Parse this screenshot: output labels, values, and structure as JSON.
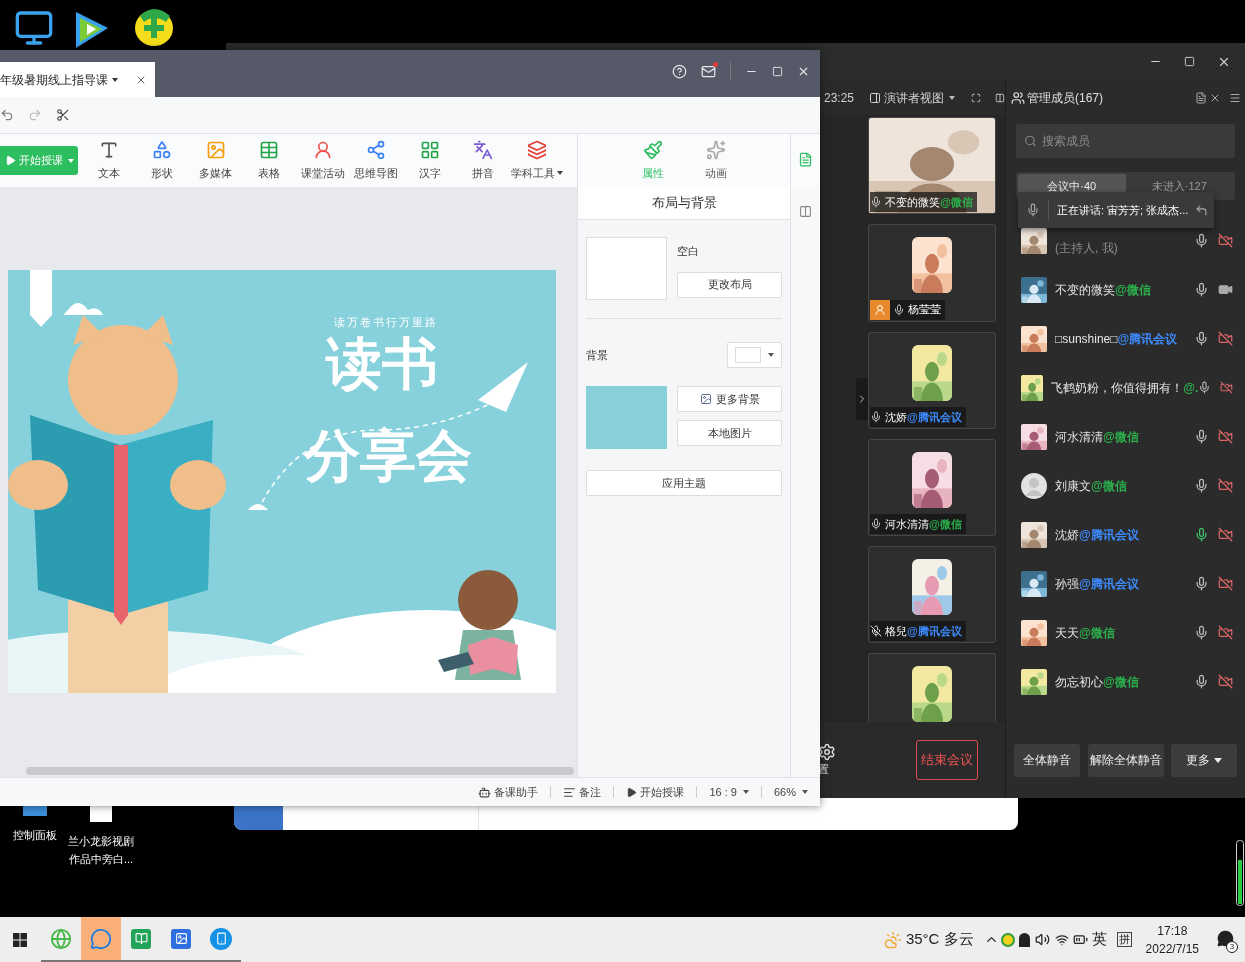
{
  "desktop": {
    "bottom_icons": [
      {
        "kind": "control",
        "lines": [
          "控制面板"
        ]
      },
      {
        "kind": "file",
        "lines": [
          "兰小龙影视剧",
          "作品中旁白..."
        ]
      }
    ]
  },
  "editor": {
    "tab_title": "年级暑期线上指导课",
    "start_button": "开始授课",
    "tools": [
      {
        "kind": "text",
        "label": "文本",
        "has_menu": false
      },
      {
        "kind": "shape",
        "label": "形状",
        "has_menu": false
      },
      {
        "kind": "media",
        "label": "多媒体",
        "has_menu": false
      },
      {
        "kind": "table",
        "label": "表格",
        "has_menu": false
      },
      {
        "kind": "activity",
        "label": "课堂活动",
        "has_menu": false
      },
      {
        "kind": "mindmap",
        "label": "思维导图",
        "has_menu": false
      },
      {
        "kind": "hanzi",
        "label": "汉字",
        "has_menu": false
      },
      {
        "kind": "pinyin",
        "label": "拼音",
        "has_menu": false
      },
      {
        "kind": "subject",
        "label": "学科工具",
        "has_menu": true
      }
    ],
    "side_tabs": [
      {
        "kind": "props",
        "label": "属性",
        "selected": true
      },
      {
        "kind": "anim",
        "label": "动画",
        "selected": false
      }
    ],
    "slide": {
      "subtitle": "读万卷书行万里路",
      "title_line1": "读书",
      "title_line2": "分享会"
    },
    "panel": {
      "title": "布局与背景",
      "layout_name": "空白",
      "change_layout": "更改布局",
      "background_label": "背景",
      "more_backgrounds": "更多背景",
      "local_image": "本地图片",
      "apply_theme": "应用主题"
    },
    "status_bar": [
      {
        "kind": "assistant",
        "label": "备课助手"
      },
      {
        "kind": "notes",
        "label": "备注"
      },
      {
        "kind": "play",
        "label": "开始授课"
      },
      {
        "kind": "menu",
        "label": "16 : 9"
      },
      {
        "kind": "menu",
        "label": "66%"
      }
    ]
  },
  "meeting": {
    "time": "23:25",
    "view_mode": "演讲者视图",
    "settings_label": "置",
    "end_button": "结束会议",
    "tiles": [
      {
        "kind": "video",
        "name": "不变的微笑",
        "source": "@微信",
        "color": "#2bb24c",
        "host": false,
        "mic_muted": false
      },
      {
        "kind": "avatar",
        "name": "杨莹莹",
        "host": true,
        "mic_muted": false
      },
      {
        "kind": "avatar",
        "name": "沈娇",
        "source": "@腾讯会议",
        "color": "#3d8bfd",
        "host": false,
        "mic_muted": false
      },
      {
        "kind": "avatar",
        "name": "河水清清",
        "source": "@微信",
        "color": "#2bb24c",
        "host": false,
        "mic_muted": false
      },
      {
        "kind": "avatar",
        "name": "格兒",
        "source": "@腾讯会议",
        "color": "#3d8bfd",
        "host": false,
        "mic_muted": true
      }
    ],
    "members": {
      "title": "管理成员(167)",
      "search_placeholder": "搜索成员",
      "tabs": [
        {
          "label": "会议中·40",
          "selected": true
        },
        {
          "label": "未进入·127",
          "selected": false
        }
      ],
      "speaking_banner": "正在讲话: 宙芳芳; 张成杰...",
      "rows": [
        {
          "kind": "host",
          "note": "(主持人, 我)",
          "camera_on": false,
          "speaking": false
        },
        {
          "kind": "member",
          "name": "不变的微笑",
          "source": "@微信",
          "color": "#2bb24c",
          "camera_on": true,
          "speaking": false
        },
        {
          "kind": "member",
          "name": "□sunshine□",
          "source": "@腾讯会议",
          "color": "#3d8bfd",
          "camera_on": false,
          "speaking": false
        },
        {
          "kind": "member",
          "name": "飞鹤奶粉，你值得拥有！",
          "source": "@.",
          "color": "#2bb24c",
          "camera_on": false,
          "speaking": false
        },
        {
          "kind": "member",
          "name": "河水清清",
          "source": "@微信",
          "color": "#2bb24c",
          "camera_on": false,
          "speaking": false
        },
        {
          "kind": "silhouette",
          "name": "刘康文",
          "source": "@微信",
          "color": "#2bb24c",
          "camera_on": false,
          "speaking": false
        },
        {
          "kind": "member",
          "name": "沈娇",
          "source": "@腾讯会议",
          "color": "#3d8bfd",
          "camera_on": false,
          "speaking": true
        },
        {
          "kind": "member",
          "name": "孙强",
          "source": "@腾讯会议",
          "color": "#3d8bfd",
          "camera_on": false,
          "speaking": false
        },
        {
          "kind": "member",
          "name": "天天",
          "source": "@微信",
          "color": "#2bb24c",
          "camera_on": false,
          "speaking": false
        },
        {
          "kind": "member",
          "name": "勿忘初心",
          "source": "@微信",
          "color": "#2bb24c",
          "camera_on": false,
          "speaking": false
        }
      ],
      "buttons": [
        {
          "kind": "plain",
          "label": "全体静音"
        },
        {
          "kind": "plain",
          "label": "解除全体静音"
        },
        {
          "kind": "menu",
          "label": "更多"
        }
      ]
    }
  },
  "taskbar": {
    "apps": [
      {
        "kind": "browser",
        "selected": false
      },
      {
        "kind": "chat",
        "selected": true
      },
      {
        "kind": "dictionary",
        "selected": false
      },
      {
        "kind": "gallery",
        "selected": false
      },
      {
        "kind": "phone",
        "selected": false
      }
    ],
    "weather": "35°C 多云",
    "ime": "英",
    "ime_mode": "拼",
    "time": "17:18",
    "date": "2022/7/15",
    "notifications": "3"
  }
}
